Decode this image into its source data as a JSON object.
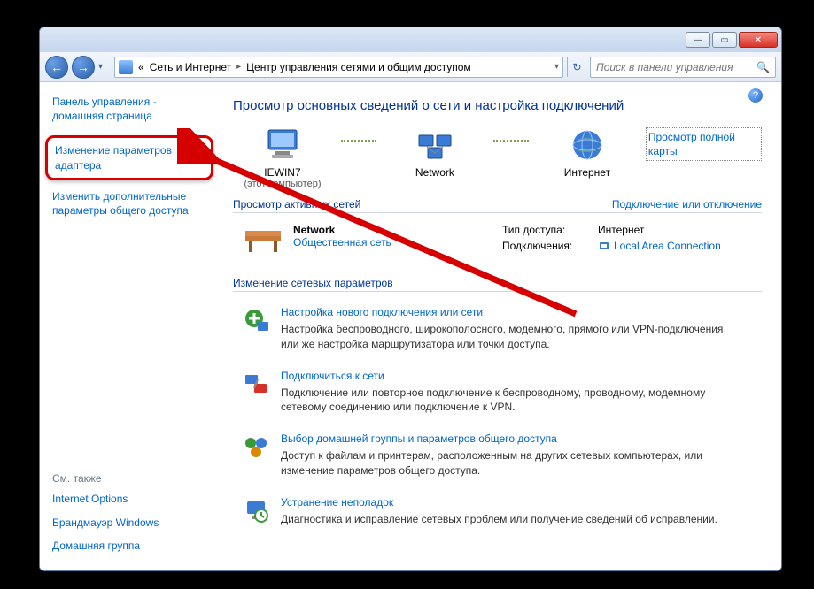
{
  "titlebar": {
    "minimize": "—",
    "maximize": "▭",
    "close": "✕"
  },
  "nav": {
    "back": "←",
    "forward": "→",
    "drop": "▾",
    "refresh": "↻",
    "addr_prefix": "«",
    "addr_seg1": "Сеть и Интернет",
    "addr_seg2": "Центр управления сетями и общим доступом",
    "addr_drop": "▾"
  },
  "search": {
    "placeholder": "Поиск в панели управления",
    "icon": "🔍"
  },
  "help": "?",
  "sidebar": {
    "home": "Панель управления - домашняя страница",
    "adapter": "Изменение параметров адаптера",
    "sharing": "Изменить дополнительные параметры общего доступа",
    "see_also": "См. также",
    "links": {
      "internet_options": "Internet Options",
      "firewall": "Брандмауэр Windows",
      "homegroup": "Домашняя группа"
    }
  },
  "main": {
    "heading": "Просмотр основных сведений о сети и настройка подключений",
    "map": {
      "computer": "IEWIN7",
      "computer_sub": "(этот компьютер)",
      "network": "Network",
      "internet": "Интернет",
      "full_map": "Просмотр полной карты"
    },
    "active_networks": {
      "header": "Просмотр активных сетей",
      "toggle": "Подключение или отключение",
      "name": "Network",
      "type": "Общественная сеть",
      "access_label": "Тип доступа:",
      "access_value": "Интернет",
      "conn_label": "Подключения:",
      "conn_value": "Local Area Connection"
    },
    "change_settings": {
      "header": "Изменение сетевых параметров",
      "items": [
        {
          "title": "Настройка нового подключения или сети",
          "desc": "Настройка беспроводного, широкополосного, модемного, прямого или VPN-подключения или же настройка маршрутизатора или точки доступа."
        },
        {
          "title": "Подключиться к сети",
          "desc": "Подключение или повторное подключение к беспроводному, проводному, модемному сетевому соединению или подключение к VPN."
        },
        {
          "title": "Выбор домашней группы и параметров общего доступа",
          "desc": "Доступ к файлам и принтерам, расположенным на других сетевых компьютерах, или изменение параметров общего доступа."
        },
        {
          "title": "Устранение неполадок",
          "desc": "Диагностика и исправление сетевых проблем или получение сведений об исправлении."
        }
      ]
    }
  }
}
